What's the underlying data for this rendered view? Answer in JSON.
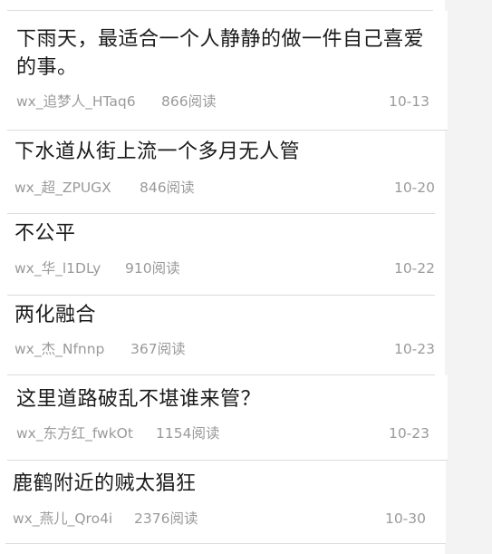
{
  "feed": {
    "items": [
      {
        "title_line1": "下雨天，最适合一个人静静的做一件自己喜爱",
        "title_line2": "的事。",
        "author": "wx_追梦人_HTaq6",
        "reads": "866阅读",
        "date": "10-13"
      },
      {
        "title_line1": "下水道从街上流一个多月无人管",
        "author": "wx_超_ZPUGX",
        "reads": "846阅读",
        "date": "10-20"
      },
      {
        "title_line1": "不公平",
        "author": "wx_华_l1DLy",
        "reads": "910阅读",
        "date": "10-22"
      },
      {
        "title_line1": "两化融合",
        "author": "wx_杰_Nfnnp",
        "reads": "367阅读",
        "date": "10-23"
      },
      {
        "title_line1": "这里道路破乱不堪谁来管？",
        "author": "wx_东方红_fwkOt",
        "reads": "1154阅读",
        "date": "10-23"
      },
      {
        "title_line1": "鹿鹤附近的贼太猖狂",
        "author": "wx_燕儿_Qro4i",
        "reads": "2376阅读",
        "date": "10-30"
      }
    ]
  }
}
